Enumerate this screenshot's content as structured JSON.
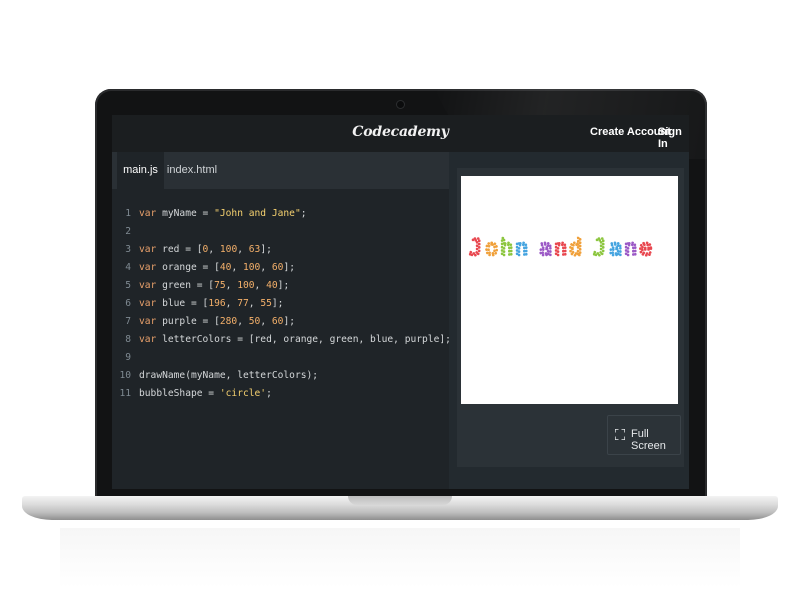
{
  "app": {
    "brand": "Codecademy",
    "nav": {
      "create_account": "Create Account",
      "sign_in": "Sign In"
    }
  },
  "editor": {
    "tabs": [
      {
        "label": "main.js",
        "active": true
      },
      {
        "label": "index.html",
        "active": false
      }
    ],
    "lines": [
      {
        "n": "1",
        "parts": [
          [
            "kw",
            "var"
          ],
          [
            "t",
            " myName = "
          ],
          [
            "str",
            "\"John and Jane\""
          ],
          [
            "t",
            ";"
          ]
        ]
      },
      {
        "n": "2",
        "parts": []
      },
      {
        "n": "3",
        "parts": [
          [
            "kw",
            "var"
          ],
          [
            "t",
            " red = ["
          ],
          [
            "num",
            "0"
          ],
          [
            "t",
            ", "
          ],
          [
            "num",
            "100"
          ],
          [
            "t",
            ", "
          ],
          [
            "num",
            "63"
          ],
          [
            "t",
            "];"
          ]
        ]
      },
      {
        "n": "4",
        "parts": [
          [
            "kw",
            "var"
          ],
          [
            "t",
            " orange = ["
          ],
          [
            "num",
            "40"
          ],
          [
            "t",
            ", "
          ],
          [
            "num",
            "100"
          ],
          [
            "t",
            ", "
          ],
          [
            "num",
            "60"
          ],
          [
            "t",
            "];"
          ]
        ]
      },
      {
        "n": "5",
        "parts": [
          [
            "kw",
            "var"
          ],
          [
            "t",
            " green = ["
          ],
          [
            "num",
            "75"
          ],
          [
            "t",
            ", "
          ],
          [
            "num",
            "100"
          ],
          [
            "t",
            ", "
          ],
          [
            "num",
            "40"
          ],
          [
            "t",
            "];"
          ]
        ]
      },
      {
        "n": "6",
        "parts": [
          [
            "kw",
            "var"
          ],
          [
            "t",
            " blue = ["
          ],
          [
            "num",
            "196"
          ],
          [
            "t",
            ", "
          ],
          [
            "num",
            "77"
          ],
          [
            "t",
            ", "
          ],
          [
            "num",
            "55"
          ],
          [
            "t",
            "];"
          ]
        ]
      },
      {
        "n": "7",
        "parts": [
          [
            "kw",
            "var"
          ],
          [
            "t",
            " purple = ["
          ],
          [
            "num",
            "280"
          ],
          [
            "t",
            ", "
          ],
          [
            "num",
            "50"
          ],
          [
            "t",
            ", "
          ],
          [
            "num",
            "60"
          ],
          [
            "t",
            "];"
          ]
        ]
      },
      {
        "n": "8",
        "parts": [
          [
            "kw",
            "var"
          ],
          [
            "t",
            " letterColors = [red, orange, green, blue, purple];"
          ]
        ]
      },
      {
        "n": "9",
        "parts": []
      },
      {
        "n": "10",
        "parts": [
          [
            "t",
            "drawName(myName, letterColors);"
          ]
        ]
      },
      {
        "n": "11",
        "parts": [
          [
            "t",
            "bubbleShape = "
          ],
          [
            "str",
            "'circle'"
          ],
          [
            "t",
            ";"
          ]
        ]
      }
    ]
  },
  "preview": {
    "drawn_text": "John and Jane",
    "full_screen_label": "Full Screen"
  },
  "colors": {
    "keyword": "#e8a06b",
    "string": "#f4d06f",
    "number": "#f4b06a",
    "bubble_red": "#e8474f",
    "bubble_orange": "#f0a03a",
    "bubble_green": "#8cc63f",
    "bubble_blue": "#45a4e0",
    "bubble_purple": "#9b59c6"
  }
}
